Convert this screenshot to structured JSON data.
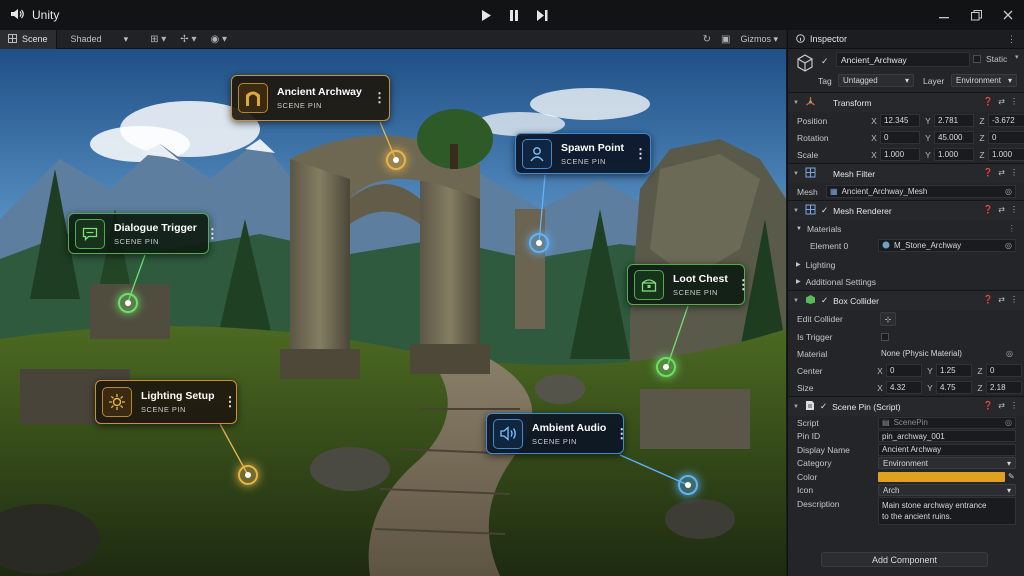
{
  "app": {
    "title": "Unity",
    "icon": "speaker-icon"
  },
  "play_controls": [
    "play-icon",
    "pause-icon",
    "step-icon"
  ],
  "window_controls": [
    "minimize-icon",
    "restore-icon",
    "close-icon"
  ],
  "scene_toolbar": {
    "tab_label": "Scene",
    "shading_mode": "Shaded",
    "gizmos_label": "Gizmos"
  },
  "scene_pins": [
    {
      "title": "Ancient Archway",
      "subtitle": "SCENE PIN",
      "icon": "archway-icon",
      "color": "#c9922d"
    },
    {
      "title": "Spawn Point",
      "subtitle": "SCENE PIN",
      "icon": "user-icon",
      "color": "#3b8bd6"
    },
    {
      "title": "Dialogue Trigger",
      "subtitle": "SCENE PIN",
      "icon": "chat-icon",
      "color": "#4fae4a"
    },
    {
      "title": "Loot Chest",
      "subtitle": "SCENE PIN",
      "icon": "chest-icon",
      "color": "#4fae4a"
    },
    {
      "title": "Lighting Setup",
      "subtitle": "SCENE PIN",
      "icon": "sun-icon",
      "color": "#c9922d"
    },
    {
      "title": "Ambient Audio",
      "subtitle": "SCENE PIN",
      "icon": "audio-icon",
      "color": "#3b8bd6"
    }
  ],
  "inspector": {
    "tab_label": "Inspector",
    "object": {
      "name": "Ancient_Archway",
      "static_label": "Static",
      "tag_label": "Tag",
      "tag_value": "Untagged",
      "layer_label": "Layer",
      "layer_value": "Environment"
    },
    "transform": {
      "title": "Transform",
      "rows": [
        {
          "label": "Position",
          "x": "12.345",
          "y": "2.781",
          "z": "-3.672"
        },
        {
          "label": "Rotation",
          "x": "0",
          "y": "45.000",
          "z": "0"
        },
        {
          "label": "Scale",
          "x": "1.000",
          "y": "1.000",
          "z": "1.000"
        }
      ]
    },
    "mesh_filter": {
      "title": "Mesh Filter",
      "mesh_label": "Mesh",
      "mesh_value": "Ancient_Archway_Mesh"
    },
    "mesh_renderer": {
      "title": "Mesh Renderer",
      "materials_label": "Materials",
      "element_label": "Element 0",
      "element_value": "M_Stone_Archway",
      "lighting_label": "Lighting",
      "additional_label": "Additional Settings"
    },
    "box_collider": {
      "title": "Box Collider",
      "edit_label": "Edit Collider",
      "trigger_label": "Is Trigger",
      "material_label": "Material",
      "material_value": "None (Physic Material)",
      "center_label": "Center",
      "center": {
        "x": "0",
        "y": "1.25",
        "z": "0"
      },
      "size_label": "Size",
      "size": {
        "x": "4.32",
        "y": "4.75",
        "z": "2.18"
      }
    },
    "scene_pin": {
      "title": "Scene Pin (Script)",
      "script_label": "Script",
      "script_value": "ScenePin",
      "pin_id_label": "Pin ID",
      "pin_id_value": "pin_archway_001",
      "display_name_label": "Display Name",
      "display_name_value": "Ancient Archway",
      "category_label": "Category",
      "category_value": "Environment",
      "color_label": "Color",
      "color_value": "#e0a020",
      "icon_label": "Icon",
      "icon_value": "Arch",
      "description_label": "Description",
      "description_line1": "Main stone archway entrance",
      "description_line2": "to the ancient ruins."
    },
    "add_component_label": "Add Component"
  }
}
